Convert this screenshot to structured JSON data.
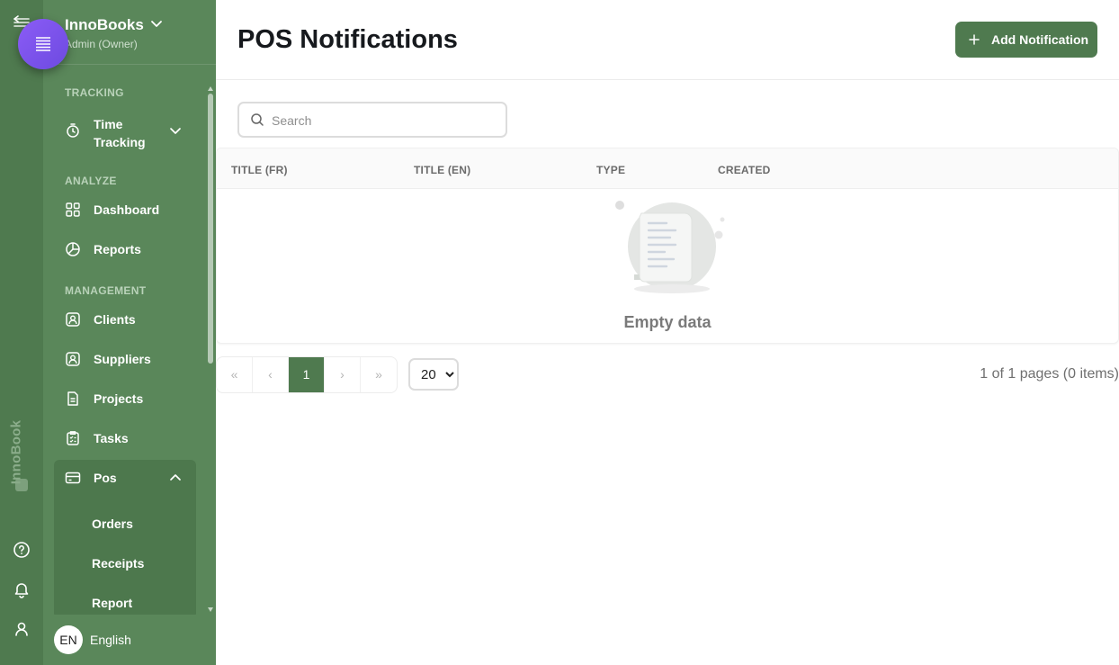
{
  "org": {
    "name": "InnoBooks",
    "role": "Admin (Owner)"
  },
  "rail": {
    "brand": "InnoBook"
  },
  "sidebar": {
    "sections": {
      "tracking": "TRACKING",
      "analyze": "ANALYZE",
      "management": "MANAGEMENT"
    },
    "items": {
      "time_tracking": "Time Tracking",
      "dashboard": "Dashboard",
      "reports": "Reports",
      "clients": "Clients",
      "suppliers": "Suppliers",
      "projects": "Projects",
      "tasks": "Tasks",
      "pos": "Pos"
    },
    "pos_sub": {
      "orders": "Orders",
      "receipts": "Receipts",
      "report": "Report"
    },
    "language": {
      "code": "EN",
      "label": "English"
    }
  },
  "header": {
    "title": "POS Notifications",
    "add_button": "Add Notification"
  },
  "search": {
    "placeholder": "Search"
  },
  "table": {
    "columns": [
      "TITLE (FR)",
      "TITLE (EN)",
      "TYPE",
      "CREATED"
    ],
    "empty_text": "Empty data"
  },
  "pagination": {
    "first": "«",
    "prev": "‹",
    "current": "1",
    "next": "›",
    "last": "»",
    "page_size": "20",
    "page_size_options": [
      "20"
    ],
    "info": "1 of 1 pages (0 items)"
  },
  "colors": {
    "sidebar": "#5a875a",
    "rail": "#4f7a4f",
    "accent": "#4f7a4f",
    "fab": "#7c4dff"
  }
}
